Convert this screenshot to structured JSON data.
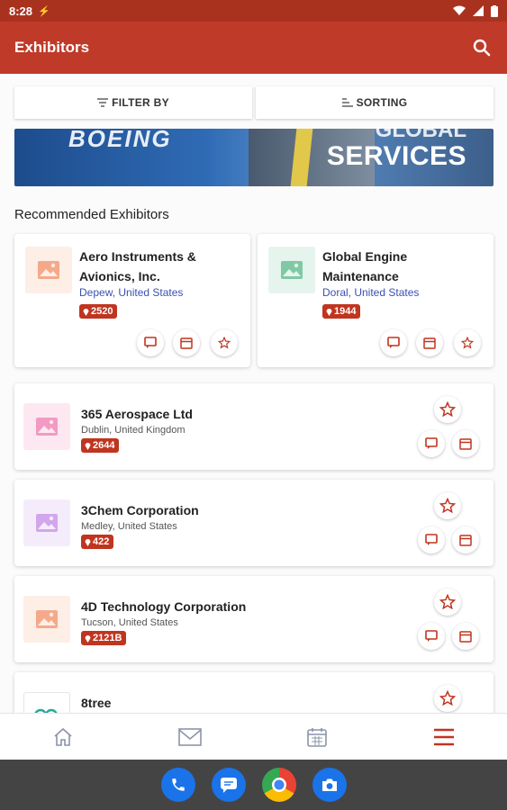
{
  "status": {
    "time": "8:28",
    "icons": [
      "wifi-icon",
      "signal-icon",
      "battery-icon"
    ]
  },
  "appbar": {
    "title": "Exhibitors",
    "search_icon": "search-icon"
  },
  "filters": {
    "filter_label": "FILTER BY",
    "sort_label": "SORTING"
  },
  "banner": {
    "brand_text": "BOEING",
    "headline_top": "GLOBAL",
    "headline": "SERVICES"
  },
  "section": {
    "title": "Recommended Exhibitors"
  },
  "recommended": [
    {
      "name": "Aero Instruments & Avionics, Inc.",
      "location": "Depew, United States",
      "booth": "2520",
      "thumb_color": "#fdeee6",
      "icon_color": "#f4a98a"
    },
    {
      "name": "Global Engine Maintenance",
      "location": "Doral, United States",
      "booth": "1944",
      "thumb_color": "#e6f4ee",
      "icon_color": "#7fc9a4"
    }
  ],
  "exhibitors": [
    {
      "name": "365 Aerospace Ltd",
      "location": "Dublin, United Kingdom",
      "booth": "2644",
      "thumb_color": "#fde8f1",
      "icon_color": "#f39ac2"
    },
    {
      "name": "3Chem Corporation",
      "location": "Medley, United States",
      "booth": "422",
      "thumb_color": "#f5ecfb",
      "icon_color": "#d2a6ec"
    },
    {
      "name": "4D Technology Corporation",
      "location": "Tucson, United States",
      "booth": "2121B",
      "thumb_color": "#fdeee6",
      "icon_color": "#f4a98a"
    },
    {
      "name": "8tree",
      "location": "",
      "booth": "",
      "thumb_color": "#ffffff",
      "icon_color": "#2aa89a"
    }
  ],
  "colors": {
    "accent": "#bf3a28",
    "status": "#a9321f",
    "link": "#3b4fb3"
  },
  "bottom_nav": [
    "home-icon",
    "mail-icon",
    "calendar-icon",
    "menu-icon"
  ],
  "dock_apps": [
    "phone-icon",
    "messages-icon",
    "chrome-icon",
    "camera-icon"
  ]
}
